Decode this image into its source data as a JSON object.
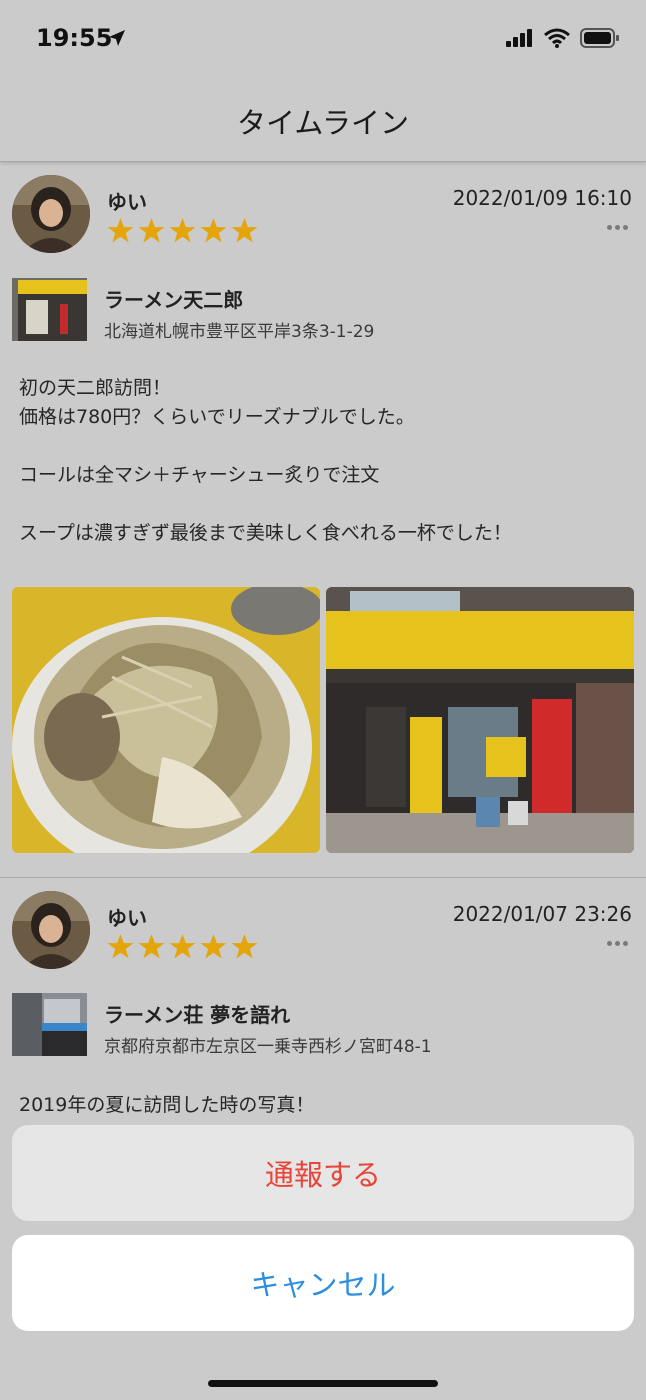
{
  "status_bar": {
    "time": "19:55"
  },
  "nav": {
    "title": "タイムライン"
  },
  "posts": [
    {
      "user": "ゆい",
      "rating": 5,
      "date": "2022/01/09 16:10",
      "shop_name": "ラーメン天二郎",
      "shop_address": "北海道札幌市豊平区平岸3条3-1-29",
      "paragraphs": [
        "初の天二郎訪問！",
        "価格は780円？くらいでリーズナブルでした。",
        "",
        "コールは全マシ＋チャーシュー炙りで注文",
        "",
        "スープは濃すぎず最後まで美味しく食べれる一杯でした！"
      ],
      "photos": [
        "ramen-bowl-photo",
        "shop-front-photo"
      ]
    },
    {
      "user": "ゆい",
      "rating": 5,
      "date": "2022/01/07 23:26",
      "shop_name": "ラーメン荘 夢を語れ",
      "shop_address": "京都府京都市左京区一乗寺西杉ノ宮町48-1",
      "paragraphs": [
        "2019年の夏に訪問した時の写真！"
      ]
    }
  ],
  "action_sheet": {
    "report_label": "通報する",
    "cancel_label": "キャンセル"
  },
  "colors": {
    "star": "#e3a50a",
    "report": "#e8453a",
    "cancel": "#2d8fe0"
  }
}
